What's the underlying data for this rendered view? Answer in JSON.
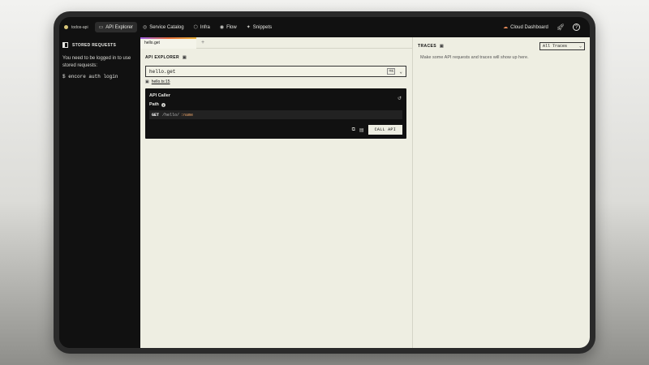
{
  "app": {
    "name": "todos-api"
  },
  "nav": {
    "items": [
      {
        "label": "API Explorer",
        "icon": "api-icon",
        "active": true
      },
      {
        "label": "Service Catalog",
        "icon": "catalog-icon",
        "active": false
      },
      {
        "label": "Infra",
        "icon": "infra-icon",
        "active": false
      },
      {
        "label": "Flow",
        "icon": "flow-icon",
        "active": false
      },
      {
        "label": "Snippets",
        "icon": "snippets-icon",
        "active": false
      }
    ],
    "cloud_dashboard": "Cloud Dashboard"
  },
  "sidebar": {
    "title": "STORED REQUESTS",
    "message": "You need to be logged in to use stored requests:",
    "command": "$ encore auth login"
  },
  "tabs": {
    "active": "hello.get",
    "add": "+"
  },
  "explorer": {
    "title": "API EXPLORER",
    "endpoint": "hello.get",
    "shortcut": "⌘K",
    "source_link": "hello.ts:15"
  },
  "caller": {
    "title": "API Caller",
    "path_label": "Path",
    "method": "GET",
    "path_base": "/hello/",
    "path_param": ":name",
    "call_button": "CALL API"
  },
  "traces": {
    "title": "TRACES",
    "filter": "All Traces",
    "empty_message": "Make some API requests and traces will show up here."
  }
}
